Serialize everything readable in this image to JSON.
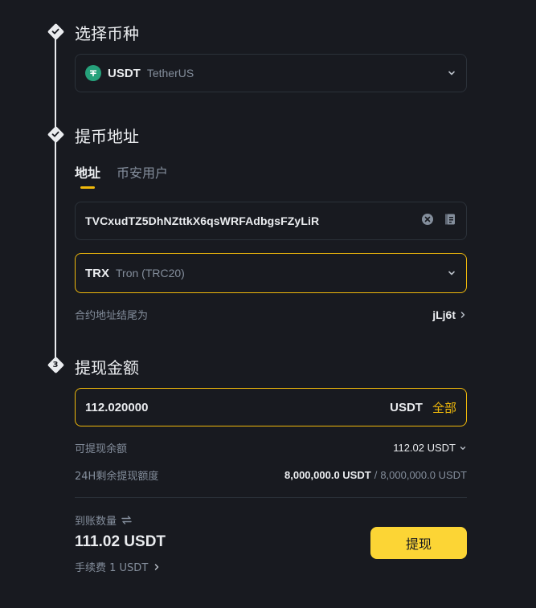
{
  "steps": {
    "step1_title": "选择币种",
    "step2_title": "提币地址",
    "step3_title": "提现金额",
    "step3_number": "3"
  },
  "coin": {
    "symbol": "USDT",
    "name": "TetherUS",
    "icon": "tether-icon",
    "icon_color": "#26a17b"
  },
  "address_tabs": [
    "地址",
    "币安用户"
  ],
  "address": {
    "value": "TVCxudTZ5DhNZttkX6qsWRFAdbgsFZyLiR"
  },
  "network": {
    "symbol": "TRX",
    "name": "Tron (TRC20)"
  },
  "contract": {
    "label": "合约地址结尾为",
    "value": "jLj6t"
  },
  "amount": {
    "value": "112.020000",
    "unit": "USDT",
    "all_label": "全部"
  },
  "available": {
    "label": "可提现余额",
    "value": "112.02 USDT"
  },
  "limit": {
    "label": "24H剩余提现额度",
    "remaining": "8,000,000.0 USDT",
    "separator": "/",
    "total": "8,000,000.0 USDT"
  },
  "receive": {
    "label": "到账数量",
    "amount": "111.02 USDT",
    "fee": "手续费 1 USDT"
  },
  "withdraw_button": "提现",
  "colors": {
    "background": "#181a20",
    "accent": "#f0b90b",
    "button": "#fcd535",
    "border": "#2b3139",
    "muted_text": "#848e9c"
  }
}
